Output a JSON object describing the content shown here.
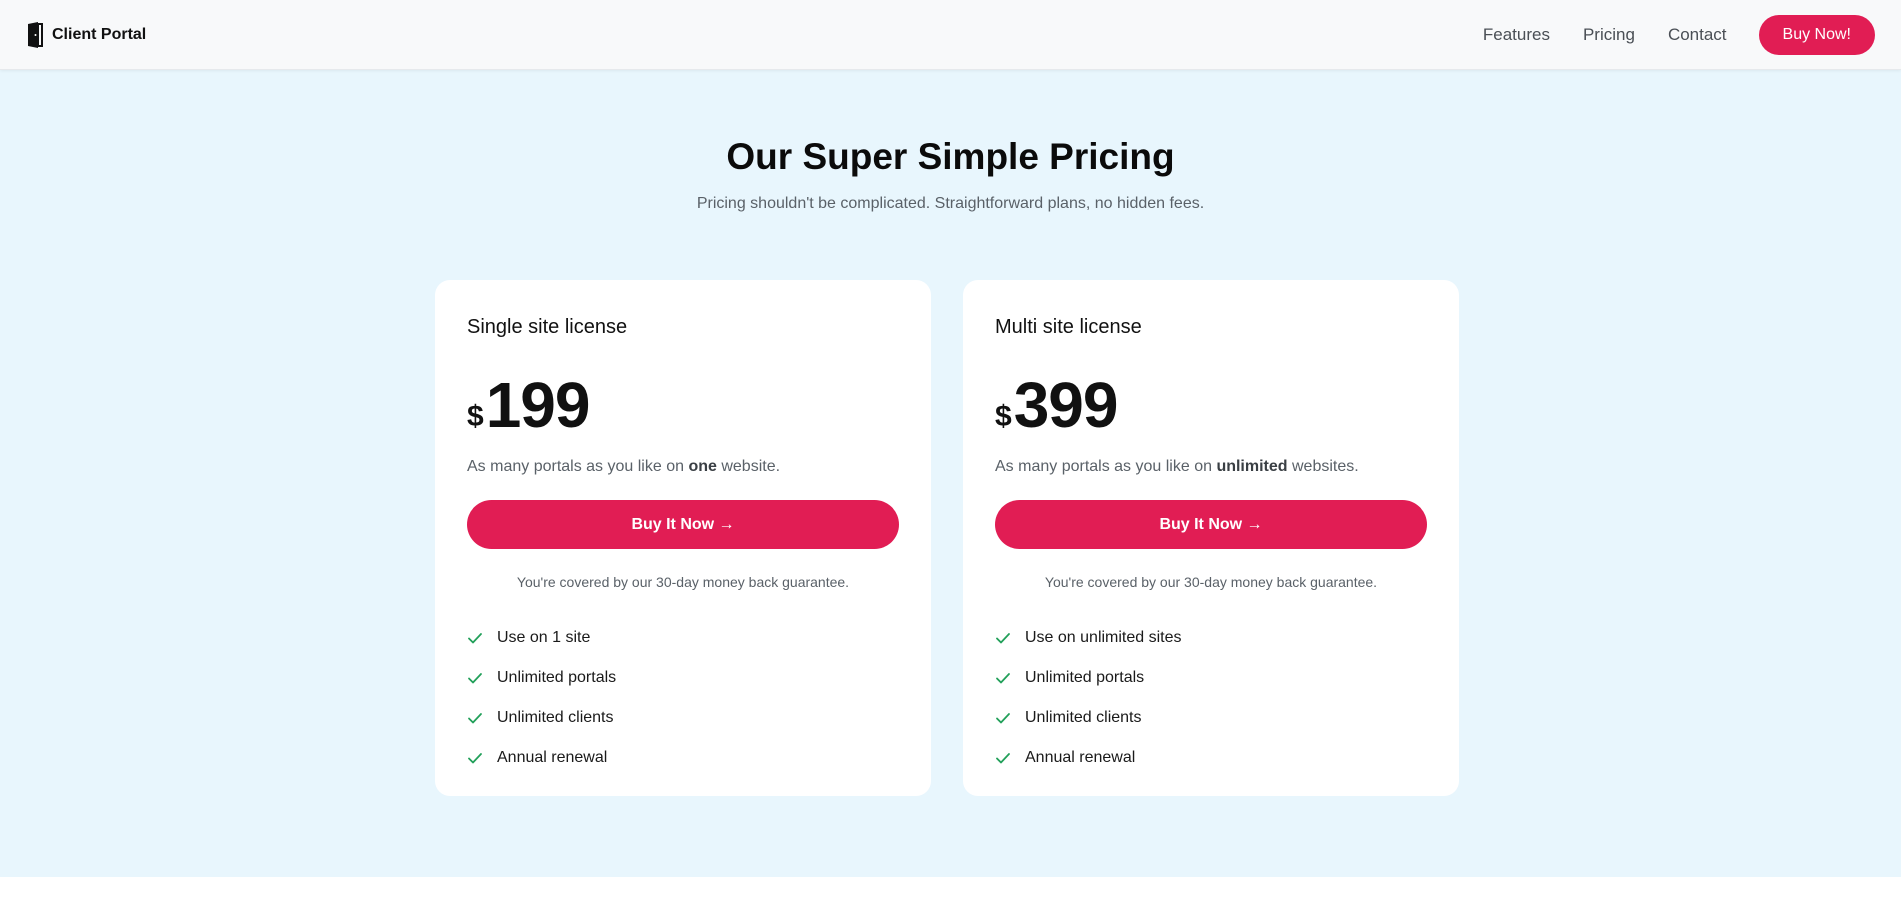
{
  "header": {
    "brand_name": "Client Portal",
    "nav": [
      "Features",
      "Pricing",
      "Contact"
    ],
    "cta_label": "Buy Now!"
  },
  "pricing": {
    "title": "Our Super Simple Pricing",
    "subtitle": "Pricing shouldn't be complicated. Straightforward plans, no hidden fees.",
    "plans": [
      {
        "name": "Single site license",
        "currency": "$",
        "price": "199",
        "desc_prefix": "As many portals as you like on ",
        "desc_bold": "one",
        "desc_suffix": " website.",
        "button_label": "Buy It Now →",
        "guarantee": "You're covered by our 30-day money back guarantee.",
        "features": [
          "Use on 1 site",
          "Unlimited portals",
          "Unlimited clients",
          "Annual renewal"
        ]
      },
      {
        "name": "Multi site license",
        "currency": "$",
        "price": "399",
        "desc_prefix": "As many portals as you like on ",
        "desc_bold": "unlimited",
        "desc_suffix": " websites.",
        "button_label": "Buy It Now →",
        "guarantee": "You're covered by our 30-day money back guarantee.",
        "features": [
          "Use on unlimited sites",
          "Unlimited portals",
          "Unlimited clients",
          "Annual renewal"
        ]
      }
    ]
  },
  "colors": {
    "accent": "#e11d54",
    "section_bg": "#e8f6fd",
    "check": "#22a05a"
  },
  "icons": {
    "brand": "door-icon",
    "feature": "check-icon"
  }
}
